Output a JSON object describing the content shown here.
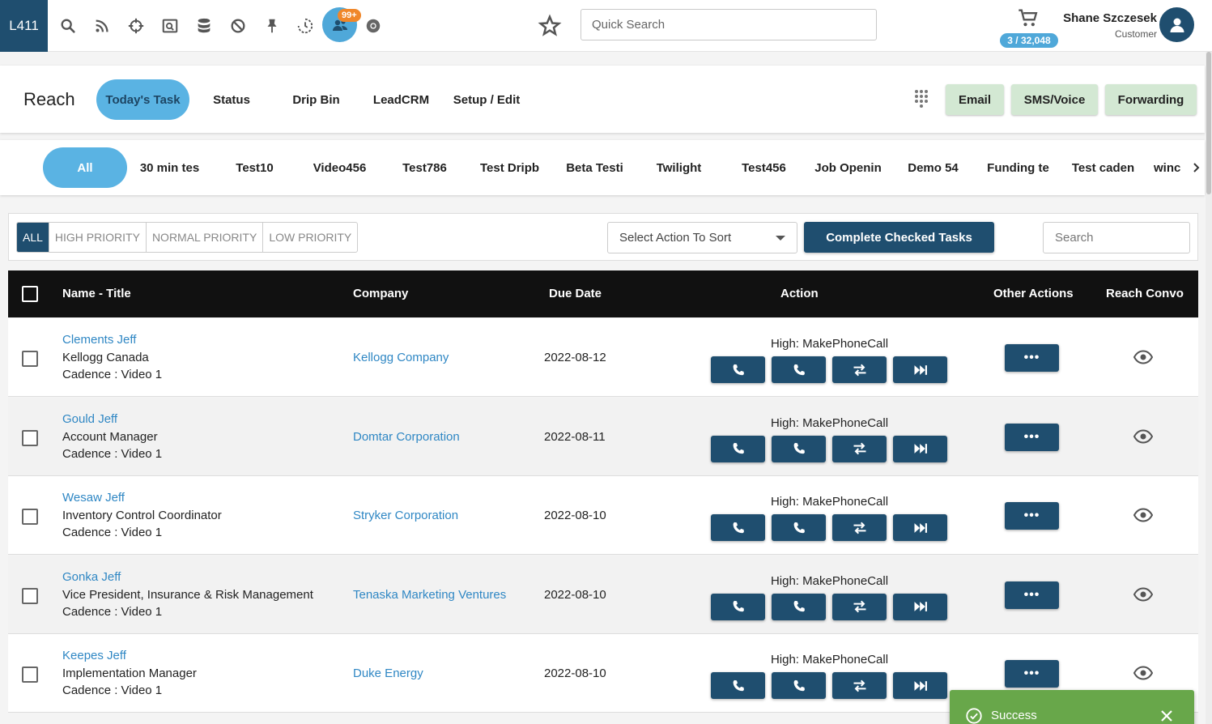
{
  "topbar": {
    "logo": "L411",
    "notification_badge": "99+",
    "quick_search_placeholder": "Quick Search",
    "cart_count": "3 / 32,048",
    "user_name": "Shane Szczesek",
    "user_role": "Customer",
    "icons": [
      "search-icon",
      "rss-icon",
      "crosshair-icon",
      "screen-search-icon",
      "database-icon",
      "ban-icon",
      "pin-icon",
      "history-icon",
      "users-icon",
      "chrome-icon",
      "star-icon",
      "cart-icon",
      "avatar-icon"
    ]
  },
  "nav": {
    "title": "Reach",
    "tabs": [
      {
        "label": "Today's Task",
        "active": true
      },
      {
        "label": "Status"
      },
      {
        "label": "Drip Bin"
      },
      {
        "label": "LeadCRM"
      },
      {
        "label": "Setup / Edit"
      }
    ],
    "buttons": [
      "Email",
      "SMS/Voice",
      "Forwarding"
    ]
  },
  "filters": {
    "tabs": [
      "All",
      "30 min tes",
      "Test10",
      "Video456",
      "Test786",
      "Test Dripb",
      "Beta Testi",
      "Twilight",
      "Test456",
      "Job Openin",
      "Demo 54",
      "Funding te",
      "Test caden",
      "winc"
    ]
  },
  "controls": {
    "priorities": [
      "ALL",
      "HIGH PRIORITY",
      "NORMAL PRIORITY",
      "LOW PRIORITY"
    ],
    "sort_placeholder": "Select Action To Sort",
    "complete_label": "Complete Checked Tasks",
    "search_placeholder": "Search"
  },
  "table": {
    "headers": {
      "name": "Name - Title",
      "company": "Company",
      "due": "Due Date",
      "action": "Action",
      "other": "Other Actions",
      "convo": "Reach Convo"
    },
    "more_label": "•••",
    "rows": [
      {
        "name": "Clements Jeff",
        "title": "Kellogg Canada",
        "cadence": "Cadence : Video 1",
        "company": "Kellogg Company",
        "due": "2022-08-12",
        "action": "High: MakePhoneCall"
      },
      {
        "name": "Gould Jeff",
        "title": "Account Manager",
        "cadence": "Cadence : Video 1",
        "company": "Domtar Corporation",
        "due": "2022-08-11",
        "action": "High: MakePhoneCall"
      },
      {
        "name": "Wesaw Jeff",
        "title": "Inventory Control Coordinator",
        "cadence": "Cadence : Video 1",
        "company": "Stryker Corporation",
        "due": "2022-08-10",
        "action": "High: MakePhoneCall"
      },
      {
        "name": "Gonka Jeff",
        "title": "Vice President, Insurance & Risk Management",
        "cadence": "Cadence : Video 1",
        "company": "Tenaska Marketing Ventures",
        "due": "2022-08-10",
        "action": "High: MakePhoneCall"
      },
      {
        "name": "Keepes Jeff",
        "title": "Implementation Manager",
        "cadence": "Cadence : Video 1",
        "company": "Duke Energy",
        "due": "2022-08-10",
        "action": "High: MakePhoneCall"
      }
    ]
  },
  "toast": {
    "message": "Success"
  },
  "colors": {
    "brand": "#1f4e6f",
    "accent": "#5ab3e3",
    "link": "#2f87c4",
    "success": "#68a74a",
    "badge": "#f0872a"
  }
}
